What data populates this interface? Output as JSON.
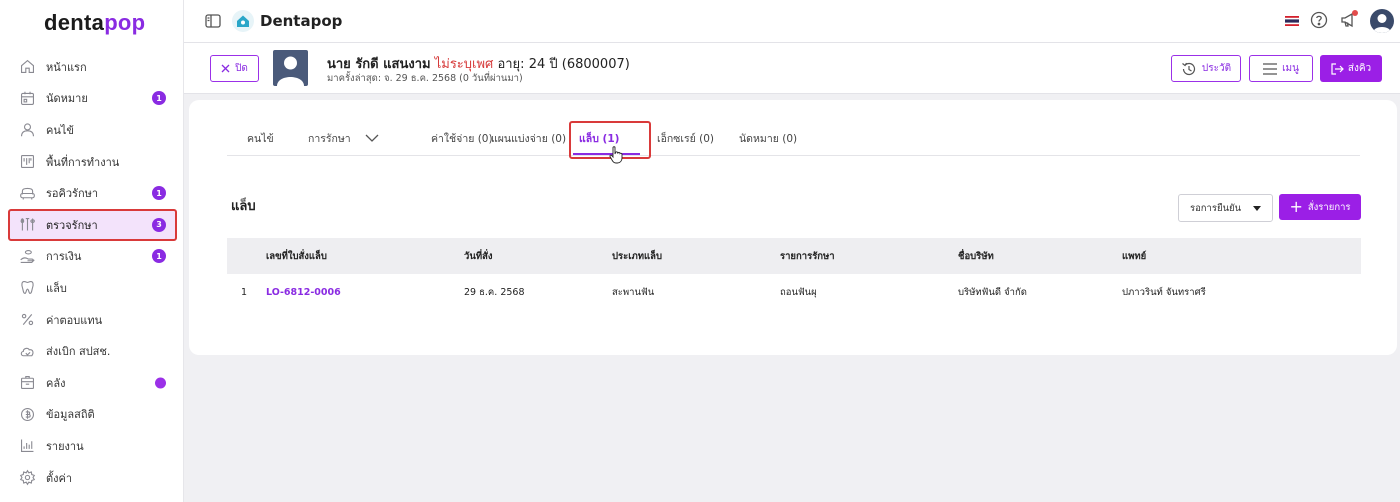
{
  "sidebar": {
    "logo_a": "denta",
    "logo_b": "pop",
    "items": [
      {
        "label": "หน้าแรก",
        "icon": "home-icon"
      },
      {
        "label": "นัดหมาย",
        "icon": "calendar-icon",
        "badge": "1"
      },
      {
        "label": "คนไข้",
        "icon": "person-icon"
      },
      {
        "label": "พื้นที่การทำงาน",
        "icon": "workspace-icon"
      },
      {
        "label": "รอคิวรักษา",
        "icon": "chair-icon",
        "badge": "1"
      },
      {
        "label": "ตรวจรักษา",
        "icon": "tools-icon",
        "badge": "3"
      },
      {
        "label": "การเงิน",
        "icon": "hand-money-icon",
        "badge": "1"
      },
      {
        "label": "แล็บ",
        "icon": "tooth-icon"
      },
      {
        "label": "ค่าตอบแทน",
        "icon": "percent-icon"
      },
      {
        "label": "ส่งเบิก สปสช.",
        "icon": "cloud-check-icon"
      },
      {
        "label": "คลัง",
        "icon": "box-icon"
      },
      {
        "label": "ข้อมูลสถิติ",
        "icon": "coin-icon"
      },
      {
        "label": "รายงาน",
        "icon": "bar-chart-icon"
      },
      {
        "label": "ตั้งค่า",
        "icon": "gear-icon"
      }
    ]
  },
  "topbar": {
    "app_name": "Dentapop"
  },
  "patient": {
    "close_label": "ปิด",
    "name": "นาย รักดี แสนงาม",
    "gender": "ไม่ระบุเพศ",
    "age_text": "อายุ: 24 ปี",
    "hn": "(6800007)",
    "last_visit": "มาครั้งล่าสุด: จ. 29 ธ.ค. 2568 (0 วันที่ผ่านมา)",
    "history_label": "ประวัติ",
    "menu_label": "เมนู",
    "queue_label": "ส่งคิว"
  },
  "tabs": [
    {
      "label": "คนไข้"
    },
    {
      "label": "การรักษา"
    },
    {
      "label": "ค่าใช้จ่าย (0)"
    },
    {
      "label": "แผนแบ่งจ่าย (0)"
    },
    {
      "label": "แล็บ (1)"
    },
    {
      "label": "เอ็กซเรย์ (0)"
    },
    {
      "label": "นัดหมาย (0)"
    }
  ],
  "lab": {
    "title": "แล็บ",
    "filter_value": "รอการยืนยัน",
    "add_label": "สั่งรายการ",
    "columns": [
      "เลขที่ใบสั่งแล็บ",
      "วันที่สั่ง",
      "ประเภทแล็บ",
      "รายการรักษา",
      "ชื่อบริษัท",
      "แพทย์"
    ],
    "rows": [
      {
        "no": "1",
        "order_no": "LO-6812-0006",
        "date": "29 ธ.ค. 2568",
        "type": "สะพานฟัน",
        "treatment": "ถอนฟันผุ",
        "company": "บริษัทฟันดี จำกัด",
        "doctor": "ปภาวรินท์ จันทราศรี"
      }
    ]
  }
}
